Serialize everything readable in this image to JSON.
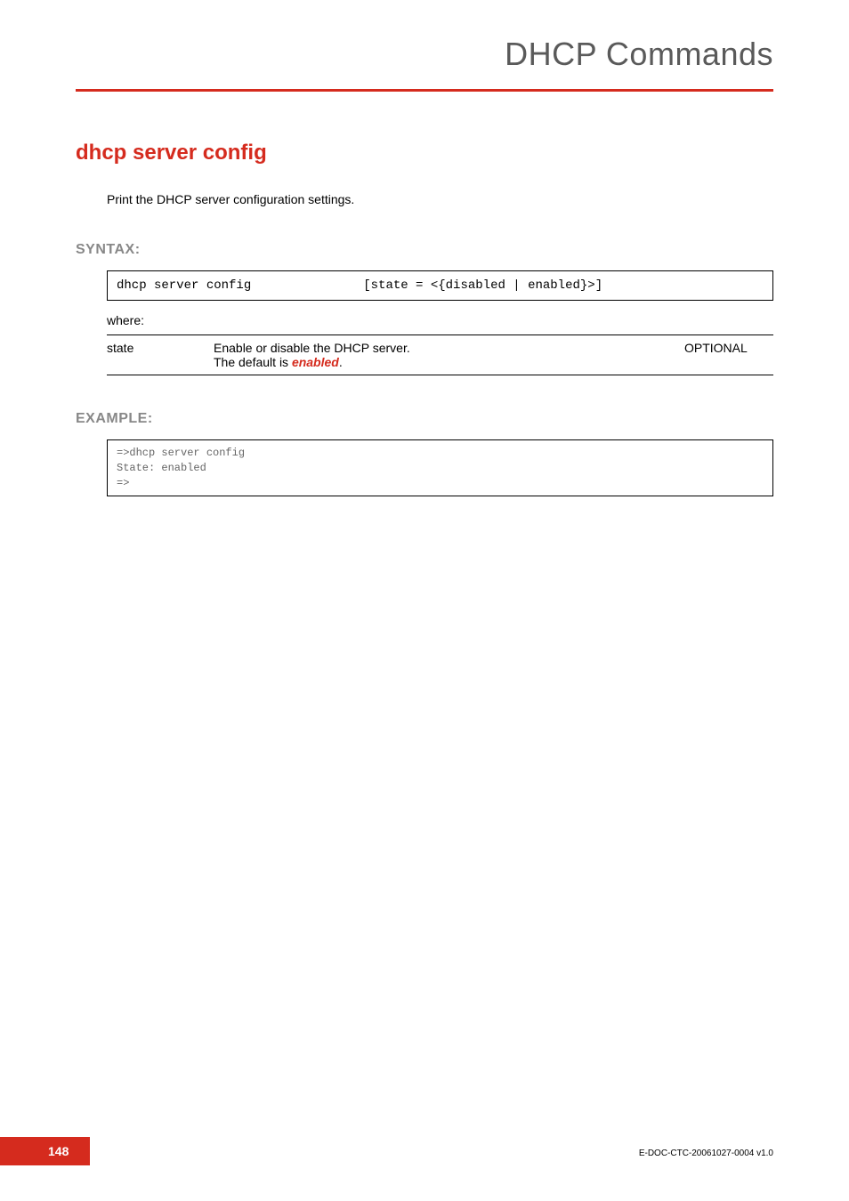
{
  "header": {
    "chapter_title": "DHCP Commands"
  },
  "section": {
    "title": "dhcp server config",
    "intro": "Print the DHCP server configuration settings."
  },
  "syntax": {
    "label": "SYNTAX:",
    "command": "dhcp server config               [state = <{disabled | enabled}>]",
    "where": "where:"
  },
  "params": [
    {
      "name": "state",
      "desc_prefix": "Enable or disable the DHCP server.",
      "desc_default_prefix": "The default is ",
      "desc_default_value": "enabled",
      "desc_suffix": ".",
      "req": "OPTIONAL"
    }
  ],
  "example": {
    "label": "EXAMPLE:",
    "text": "=>dhcp server config\nState: enabled\n=>"
  },
  "footer": {
    "page": "148",
    "doc_id": "E-DOC-CTC-20061027-0004 v1.0"
  }
}
